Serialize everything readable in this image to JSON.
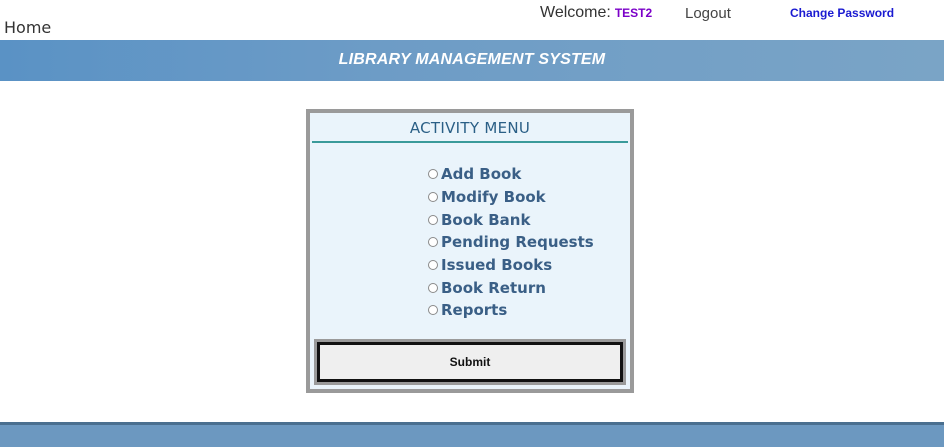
{
  "topbar": {
    "home_label": "Home",
    "welcome_label": "Welcome:",
    "username": "TEST2",
    "logout_label": "Logout",
    "change_password_label": "Change Password"
  },
  "banner": {
    "title": "LIBRARY MANAGEMENT SYSTEM"
  },
  "activity_menu": {
    "title": "ACTIVITY MENU",
    "items": [
      {
        "label": "Add Book"
      },
      {
        "label": "Modify Book"
      },
      {
        "label": "Book Bank"
      },
      {
        "label": "Pending Requests"
      },
      {
        "label": "Issued Books"
      },
      {
        "label": "Book Return"
      },
      {
        "label": "Reports"
      }
    ],
    "submit_label": "Submit"
  },
  "colors": {
    "banner": "#6d9cc6",
    "panel_bg": "#eaf4fb",
    "menu_text": "#3a5f86",
    "username": "#7b00c8",
    "link": "#1a1ad1"
  }
}
